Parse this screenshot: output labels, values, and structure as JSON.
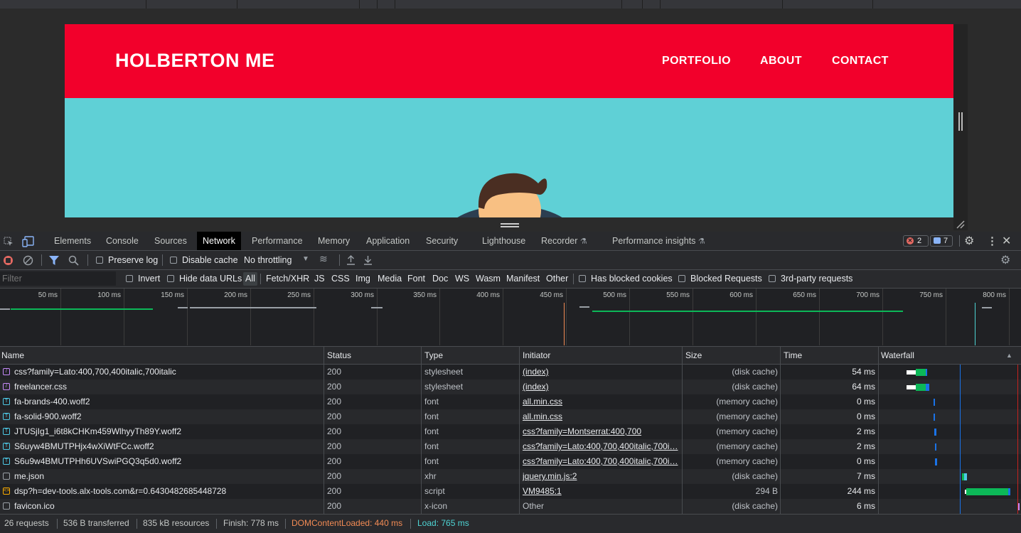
{
  "site": {
    "title": "HOLBERTON ME",
    "nav": [
      "PORTFOLIO",
      "ABOUT",
      "CONTACT"
    ],
    "header_color": "#f2002b",
    "hero_color": "#5fd0d6"
  },
  "devtools": {
    "tabs": [
      "Elements",
      "Console",
      "Sources",
      "Network",
      "Performance",
      "Memory",
      "Application",
      "Security",
      "Lighthouse",
      "Recorder",
      "Performance insights"
    ],
    "active_tab": "Network",
    "errors_count": "2",
    "messages_count": "7",
    "toolbar": {
      "preserve_log": "Preserve log",
      "disable_cache": "Disable cache",
      "throttling": "No throttling"
    },
    "filter": {
      "placeholder": "Filter",
      "invert": "Invert",
      "hide_data_urls": "Hide data URLs",
      "types": [
        "All",
        "Fetch/XHR",
        "JS",
        "CSS",
        "Img",
        "Media",
        "Font",
        "Doc",
        "WS",
        "Wasm",
        "Manifest",
        "Other"
      ],
      "has_blocked_cookies": "Has blocked cookies",
      "blocked_requests": "Blocked Requests",
      "third_party": "3rd-party requests"
    },
    "overview_ticks": [
      "50 ms",
      "100 ms",
      "150 ms",
      "200 ms",
      "250 ms",
      "300 ms",
      "350 ms",
      "400 ms",
      "450 ms",
      "500 ms",
      "550 ms",
      "600 ms",
      "650 ms",
      "700 ms",
      "750 ms",
      "800 ms"
    ],
    "columns": {
      "name": "Name",
      "status": "Status",
      "type": "Type",
      "initiator": "Initiator",
      "size": "Size",
      "time": "Time",
      "waterfall": "Waterfall"
    },
    "requests": [
      {
        "name": "css?family=Lato:400,700,400italic,700italic",
        "status": "200",
        "type": "stylesheet",
        "initiator": "(index)",
        "size": "(disk cache)",
        "time": "54 ms",
        "icon": "stylesheet-icon"
      },
      {
        "name": "freelancer.css",
        "status": "200",
        "type": "stylesheet",
        "initiator": "(index)",
        "size": "(disk cache)",
        "time": "64 ms",
        "icon": "stylesheet-icon"
      },
      {
        "name": "fa-brands-400.woff2",
        "status": "200",
        "type": "font",
        "initiator": "all.min.css",
        "size": "(memory cache)",
        "time": "0 ms",
        "icon": "font-icon"
      },
      {
        "name": "fa-solid-900.woff2",
        "status": "200",
        "type": "font",
        "initiator": "all.min.css",
        "size": "(memory cache)",
        "time": "0 ms",
        "icon": "font-icon"
      },
      {
        "name": "JTUSjIg1_i6t8kCHKm459WlhyyTh89Y.woff2",
        "status": "200",
        "type": "font",
        "initiator": "css?family=Montserrat:400,700",
        "size": "(memory cache)",
        "time": "2 ms",
        "icon": "font-icon"
      },
      {
        "name": "S6uyw4BMUTPHjx4wXiWtFCc.woff2",
        "status": "200",
        "type": "font",
        "initiator": "css?family=Lato:400,700,400italic,700i…",
        "size": "(memory cache)",
        "time": "2 ms",
        "icon": "font-icon"
      },
      {
        "name": "S6u9w4BMUTPHh6UVSwiPGQ3q5d0.woff2",
        "status": "200",
        "type": "font",
        "initiator": "css?family=Lato:400,700,400italic,700i…",
        "size": "(memory cache)",
        "time": "0 ms",
        "icon": "font-icon"
      },
      {
        "name": "me.json",
        "status": "200",
        "type": "xhr",
        "initiator": "jquery.min.js:2",
        "size": "(disk cache)",
        "time": "7 ms",
        "icon": "xhr-icon"
      },
      {
        "name": "dsp?h=dev-tools.alx-tools.com&r=0.6430482685448728",
        "status": "200",
        "type": "script",
        "initiator": "VM9485:1",
        "size": "294 B",
        "time": "244 ms",
        "icon": "script-icon"
      },
      {
        "name": "favicon.ico",
        "status": "200",
        "type": "x-icon",
        "initiator": "Other",
        "size": "(disk cache)",
        "time": "6 ms",
        "icon": "file-icon"
      }
    ],
    "status_bar": {
      "requests": "26 requests",
      "transferred": "536 B transferred",
      "resources": "835 kB resources",
      "finish": "Finish: 778 ms",
      "dom_content_loaded": "DOMContentLoaded: 440 ms",
      "load": "Load: 765 ms"
    },
    "colors": {
      "dcl": "#f28b54",
      "load": "#4ed4d4",
      "bar_green": "#0cb858",
      "bar_blue": "#1a73e8"
    }
  }
}
